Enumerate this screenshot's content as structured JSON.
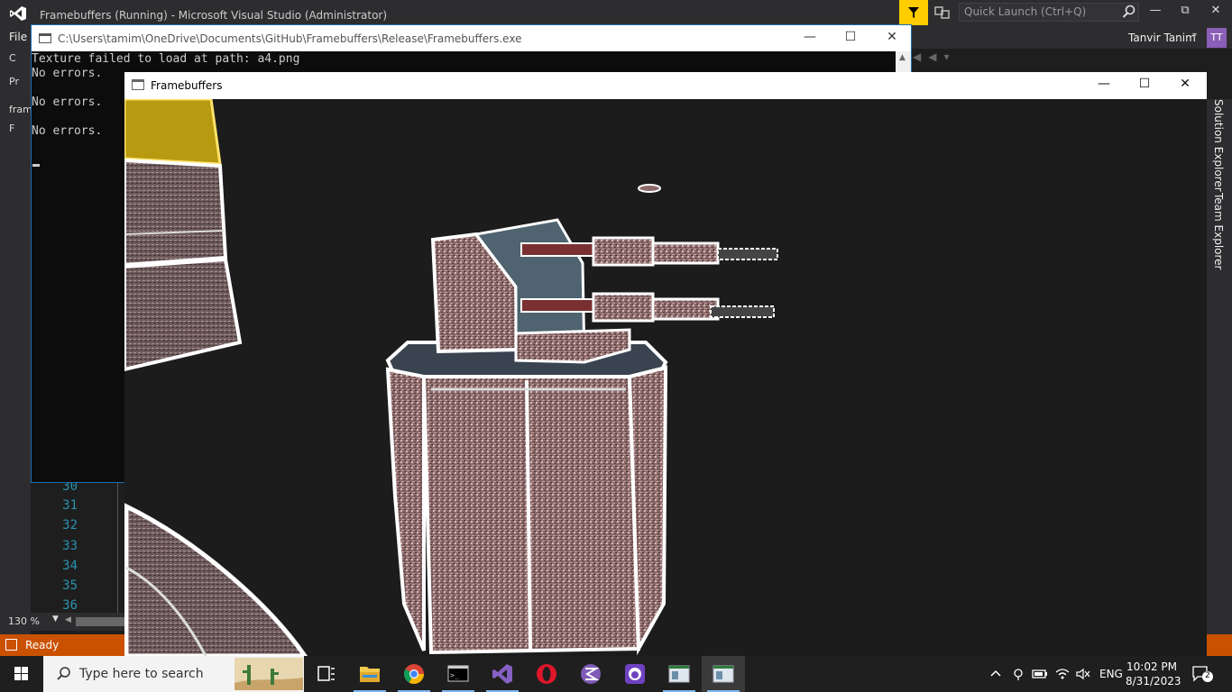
{
  "vs": {
    "title": "Framebuffers (Running) - Microsoft Visual Studio (Administrator)",
    "quick_launch_placeholder": "Quick Launch (Ctrl+Q)",
    "menu_file": "File",
    "user_name": "Tanvir Tanim",
    "user_initials": "TT",
    "left_strip": [
      "C",
      "Pr",
      "fram",
      "F"
    ],
    "line_numbers": [
      "30",
      "31",
      "32",
      "33",
      "34",
      "35",
      "36"
    ],
    "zoom": "130 %",
    "status": "Ready",
    "side_tabs": [
      "Solution Explorer",
      "Team Explorer"
    ],
    "accent_color": "#ca5100",
    "filter_color": "#ffcc00"
  },
  "console": {
    "path": "C:\\Users\\tamim\\OneDrive\\Documents\\GitHub\\Framebuffers\\Release\\Framebuffers.exe",
    "lines": [
      "Texture failed to load at path: a4.png",
      "No errors.",
      "No errors.",
      "No errors."
    ]
  },
  "framebuffers": {
    "title": "Framebuffers"
  },
  "taskbar": {
    "search_placeholder": "Type here to search",
    "apps": [
      "task-view",
      "file-explorer",
      "chrome",
      "terminal",
      "visual-studio",
      "opera",
      "emacs",
      "github-desktop",
      "app-window-1",
      "app-window-2"
    ],
    "time": "10:02 PM",
    "date": "8/31/2023",
    "language": "ENG",
    "notifications": "2"
  }
}
